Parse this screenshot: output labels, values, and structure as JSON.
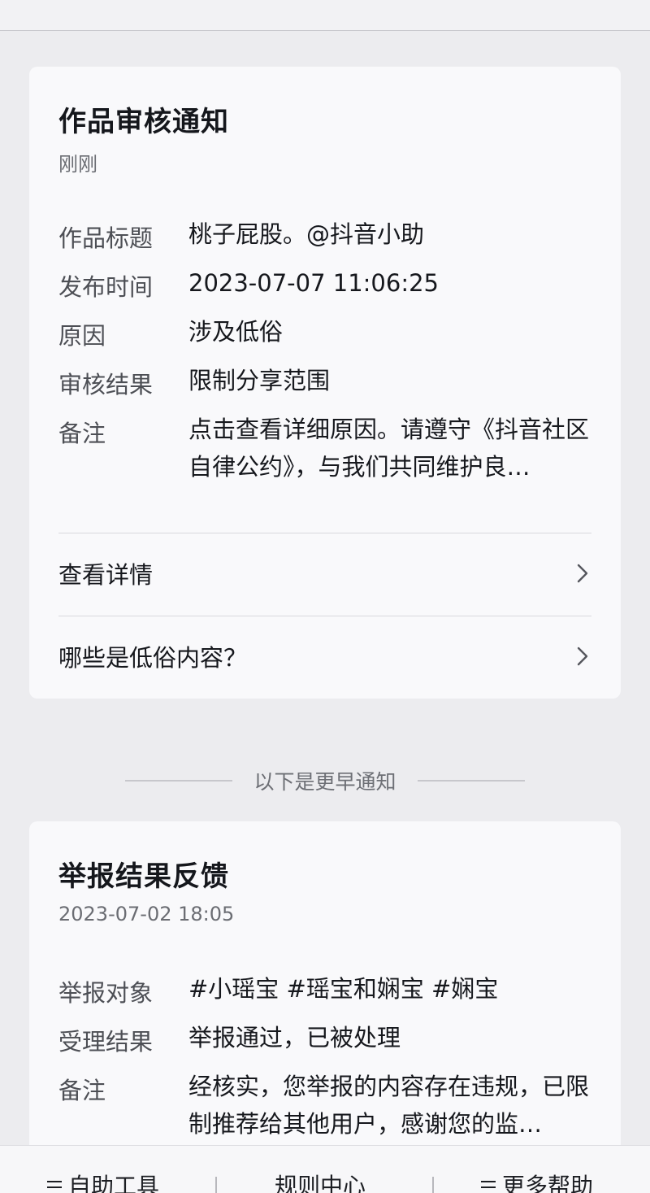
{
  "card1": {
    "title": "作品审核通知",
    "time": "刚刚",
    "rows": [
      {
        "label": "作品标题",
        "value": "桃子屁股。@抖音小助"
      },
      {
        "label": "发布时间",
        "value": "2023-07-07 11:06:25"
      },
      {
        "label": "原因",
        "value": "涉及低俗"
      },
      {
        "label": "审核结果",
        "value": "限制分享范围"
      },
      {
        "label": "备注",
        "value": "点击查看详细原因。请遵守《抖音社区自律公约》，与我们共同维护良…"
      }
    ],
    "links": [
      "查看详情",
      "哪些是低俗内容？"
    ]
  },
  "separator": "以下是更早通知",
  "card2": {
    "title": "举报结果反馈",
    "time": "2023-07-02 18:05",
    "rows": [
      {
        "label": "举报对象",
        "value": "#小瑶宝 #瑶宝和娴宝 #娴宝"
      },
      {
        "label": "受理结果",
        "value": "举报通过，已被处理"
      },
      {
        "label": "备注",
        "value": "经核实，您举报的内容存在违规，已限制推荐给其他用户，感谢您的监…"
      }
    ]
  },
  "bottom_bar": {
    "items": [
      "自助工具",
      "规则中心",
      "更多帮助"
    ]
  }
}
